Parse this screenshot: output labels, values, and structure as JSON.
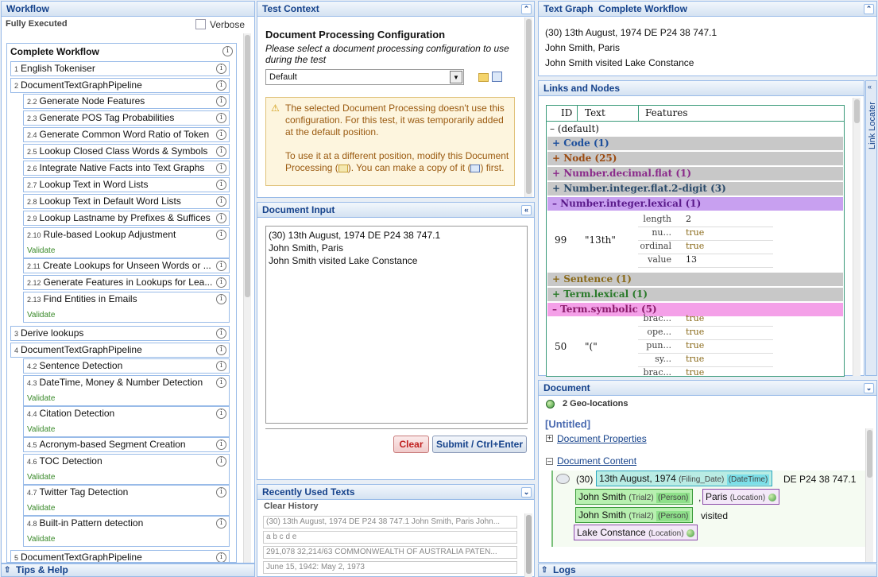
{
  "workflow": {
    "title": "Workflow",
    "status": "Fully Executed",
    "verbose_label": "Verbose",
    "root_label": "Complete Workflow",
    "validate_label": "Validate",
    "items": [
      {
        "num": "1",
        "label": "English Tokeniser"
      },
      {
        "num": "2",
        "label": "DocumentTextGraphPipeline"
      },
      {
        "num": "2.2",
        "label": "Generate Node Features"
      },
      {
        "num": "2.3",
        "label": "Generate POS Tag Probabilities"
      },
      {
        "num": "2.4",
        "label": "Generate Common Word Ratio of Token"
      },
      {
        "num": "2.5",
        "label": "Lookup Closed Class Words & Symbols"
      },
      {
        "num": "2.6",
        "label": "Integrate Native Facts into Text Graphs"
      },
      {
        "num": "2.7",
        "label": "Lookup Text in Word Lists"
      },
      {
        "num": "2.8",
        "label": "Lookup Text in Default Word Lists"
      },
      {
        "num": "2.9",
        "label": "Lookup Lastname by Prefixes & Suffices"
      },
      {
        "num": "2.10",
        "label": "Rule-based Lookup Adjustment"
      },
      {
        "num": "2.11",
        "label": "Create Lookups for Unseen Words or ..."
      },
      {
        "num": "2.12",
        "label": "Generate Features in Lookups for Lea..."
      },
      {
        "num": "2.13",
        "label": "Find Entities in Emails"
      },
      {
        "num": "3",
        "label": "Derive lookups"
      },
      {
        "num": "4",
        "label": "DocumentTextGraphPipeline"
      },
      {
        "num": "4.2",
        "label": "Sentence Detection"
      },
      {
        "num": "4.3",
        "label": "DateTime, Money & Number Detection"
      },
      {
        "num": "4.4",
        "label": "Citation Detection"
      },
      {
        "num": "4.5",
        "label": "Acronym-based Segment Creation"
      },
      {
        "num": "4.6",
        "label": "TOC Detection"
      },
      {
        "num": "4.7",
        "label": "Twitter Tag Detection"
      },
      {
        "num": "4.8",
        "label": "Built-in Pattern detection"
      },
      {
        "num": "5",
        "label": "DocumentTextGraphPipeline"
      }
    ]
  },
  "tips_label": "Tips & Help",
  "test_context": {
    "title": "Test Context",
    "heading": "Document Processing Configuration",
    "instructions": "Please select a document processing configuration to use during the test",
    "select_value": "Default",
    "warning_p1": "The selected Document Processing doesn't use this configuration. For this test, it was temporarily added at the default position.",
    "warning_p2a": "To use it at a different position, modify this Document Processing (",
    "warning_p2b": "). You can make a copy of it (",
    "warning_p2c": ") first."
  },
  "document_input": {
    "title": "Document Input",
    "lines": [
      "(30) 13th August, 1974 DE P24 38 747.1",
      "John Smith, Paris",
      "John Smith visited Lake Constance"
    ],
    "clear_label": "Clear",
    "submit_label": "Submit / Ctrl+Enter"
  },
  "recent": {
    "title": "Recently Used Texts",
    "clear_history": "Clear History",
    "items": [
      "(30) 13th August, 1974 DE P24 38 747.1 John Smith, Paris John...",
      "a b c d e",
      "291,078 32,214/63 COMMONWEALTH OF AUSTRALIA PATEN...",
      "June 15, 1942: May 2, 1973"
    ]
  },
  "text_graph": {
    "title": "Text Graph  Complete Workflow",
    "lines": [
      "(30) 13th August, 1974 DE P24 38 747.1",
      "John Smith, Paris",
      "John Smith visited Lake Constance"
    ]
  },
  "links_nodes": {
    "title": "Links and Nodes",
    "side_tab": "Link Locater",
    "columns": [
      "ID",
      "Text",
      "Features"
    ],
    "default_row": "– (default)",
    "groups": [
      {
        "label": "+ Code (1)",
        "color": "#1d4f9c"
      },
      {
        "label": "+ Node (25)",
        "color": "#9b4a10"
      },
      {
        "label": "+ Number.decimal.flat (1)",
        "color": "#8a2a8a"
      },
      {
        "label": "+ Number.integer.flat.2-digit (3)",
        "color": "#2a4a6a"
      },
      {
        "label": "– Number.integer.lexical (1)",
        "color": "#5a1a8a"
      },
      {
        "label": "+ Sentence (1)",
        "color": "#8a6a1a"
      },
      {
        "label": "+ Term.lexical (1)",
        "color": "#2a7a2a"
      },
      {
        "label": "– Term.symbolic (5)",
        "color": "#8a1a6a"
      }
    ],
    "node1": {
      "id": "99",
      "text": "\"13th\"",
      "features": [
        [
          "length",
          "2"
        ],
        [
          "nu...",
          "true"
        ],
        [
          "ordinal",
          "true"
        ],
        [
          "value",
          "13"
        ]
      ]
    },
    "node2": {
      "id": "50",
      "text": "\"(\"",
      "features": [
        [
          "brac...",
          "true"
        ],
        [
          "ope...",
          "true"
        ],
        [
          "pun...",
          "true"
        ],
        [
          "sy...",
          "true"
        ],
        [
          "brac...",
          "true"
        ]
      ]
    }
  },
  "document": {
    "title": "Document",
    "geo": "2 Geo-locations",
    "untitled": "[Untitled]",
    "properties": "Document Properties",
    "content": "Document Content",
    "ann": {
      "prefix": "(30)",
      "date": "13th August, 1974",
      "date_type1": "(Filing_Date)",
      "date_type2": "(DateTime)",
      "rest": "DE P24 38 747.1",
      "p1": "John Smith",
      "p1_t1": "(Trial2)",
      "p1_t2": "(Person)",
      "comma": ",",
      "loc1": "Paris",
      "loc1_t": "(Location)",
      "p2": "John Smith",
      "p2_t1": "(Trial2)",
      "p2_t2": "(Person)",
      "visited": "visited",
      "loc2": "Lake Constance",
      "loc2_t": "(Location)"
    }
  },
  "logs_label": "Logs"
}
